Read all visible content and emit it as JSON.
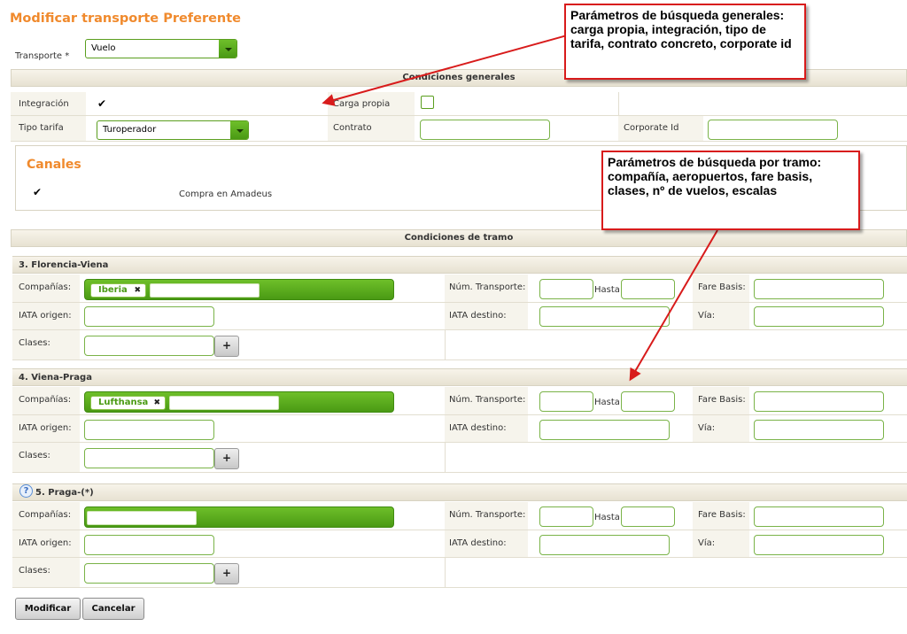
{
  "page": {
    "title": "Modificar transporte Preferente"
  },
  "transporte": {
    "label": "Transporte *",
    "value": "Vuelo"
  },
  "condiciones_generales": {
    "header": "Condiciones generales",
    "integracion_label": "Integración",
    "integracion_checked": true,
    "carga_propia_label": "Carga propia",
    "carga_propia_checked": false,
    "tipo_tarifa_label": "Tipo tarifa",
    "tipo_tarifa_value": "Turoperador",
    "contrato_label": "Contrato",
    "contrato_value": "",
    "corporate_id_label": "Corporate Id",
    "corporate_id_value": ""
  },
  "canales": {
    "title": "Canales",
    "items": [
      {
        "label": "Compra en Amadeus",
        "checked": true
      }
    ]
  },
  "condiciones_tramo": {
    "header": "Condiciones de tramo",
    "labels": {
      "companias": "Compañías:",
      "num_transporte": "Núm. Transporte:",
      "hasta": "Hasta",
      "fare_basis": "Fare Basis:",
      "iata_origen": "IATA origen:",
      "iata_destino": "IATA destino:",
      "via": "Vía:",
      "clases": "Clases:"
    },
    "add_icon": "plus-icon",
    "tramos": [
      {
        "title": "3. Florencia-Viena",
        "companias": [
          "Iberia"
        ],
        "has_help": false
      },
      {
        "title": "4. Viena-Praga",
        "companias": [
          "Lufthansa"
        ],
        "has_help": false
      },
      {
        "title": "5. Praga-(*)",
        "companias": [],
        "has_help": true
      }
    ]
  },
  "actions": {
    "modificar": "Modificar",
    "cancelar": "Cancelar"
  },
  "annotations": {
    "note_generales": "Parámetros de búsqueda generales: carga propia, integración, tipo de tarifa, contrato concreto, corporate id",
    "note_tramo": "Parámetros de búsqueda por tramo:  compañía, aeropuertos, fare basis, clases, nº de vuelos, escalas"
  },
  "icons": {
    "check": "✔",
    "remove_tag": "✖",
    "help": "?"
  },
  "colors": {
    "accent_orange": "#f08a2d",
    "green": "#5a9e1e",
    "annotation_red": "#d81b1b"
  }
}
